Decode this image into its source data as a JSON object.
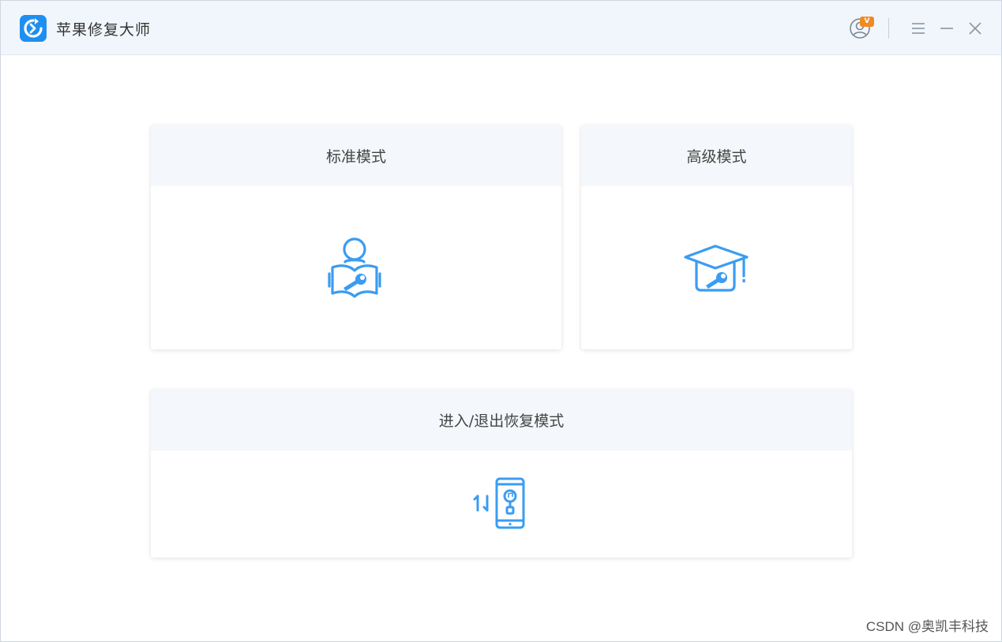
{
  "window": {
    "title": "苹果修复大师",
    "icons": {
      "logo": "app-logo-icon",
      "user": "user-account-icon",
      "menu": "menu-icon",
      "minimize": "minimize-icon",
      "close": "close-icon"
    },
    "vip_badge": "V"
  },
  "modes": [
    {
      "label": "标准模式",
      "icon": "person-wrench-book-icon"
    },
    {
      "label": "高级模式",
      "icon": "graduation-cap-wrench-icon"
    },
    {
      "label": "进入/退出恢复模式",
      "icon": "phone-itunes-transfer-icon"
    }
  ],
  "watermark": "CSDN @奥凯丰科技",
  "colors": {
    "accent": "#1e8ff0",
    "icon_blue": "#3b9cf2",
    "titlebar_bg": "#f1f6fc",
    "card_header_bg": "#f4f7fb",
    "badge_orange": "#f08a24"
  }
}
